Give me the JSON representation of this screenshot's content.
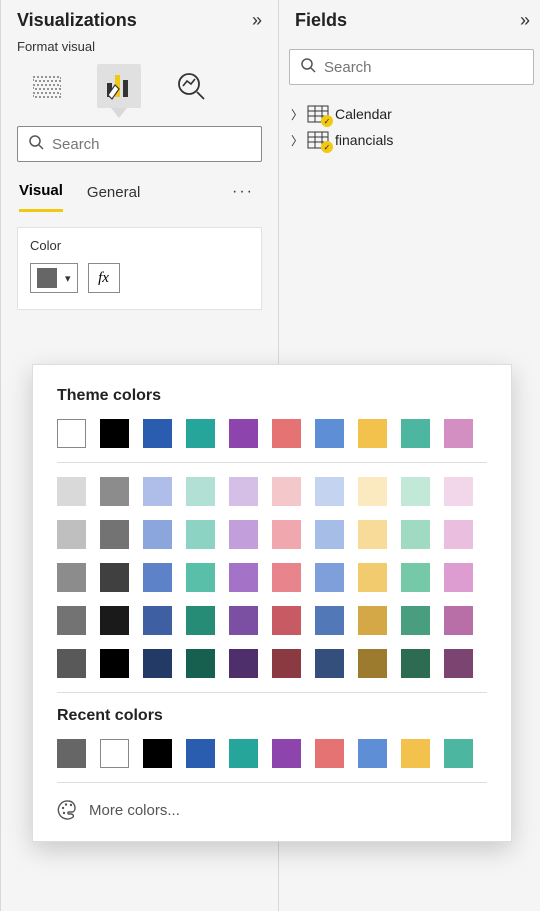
{
  "viz": {
    "title": "Visualizations",
    "subtitle": "Format visual",
    "search_placeholder": "Search",
    "tabs": {
      "visual": "Visual",
      "general": "General"
    },
    "card": {
      "label": "Color",
      "fx": "fx"
    }
  },
  "fields": {
    "title": "Fields",
    "search_placeholder": "Search",
    "items": [
      {
        "label": "Calendar"
      },
      {
        "label": "financials"
      }
    ]
  },
  "picker": {
    "theme_heading": "Theme colors",
    "recent_heading": "Recent colors",
    "more_label": "More colors...",
    "theme_base": [
      "#FFFFFF",
      "#000000",
      "#2A5DB0",
      "#26A69A",
      "#8E44AD",
      "#E57373",
      "#5E8ED6",
      "#F2C24C",
      "#4DB6A0",
      "#D48FC2"
    ],
    "theme_tints": [
      [
        "#D9D9D9",
        "#8C8C8C",
        "#AEBEE8",
        "#B2E0D5",
        "#D6BFE6",
        "#F4C7CB",
        "#C4D3EF",
        "#FBE9BF",
        "#C2E8D8",
        "#F2D7EA"
      ],
      [
        "#BFBFBF",
        "#737373",
        "#8BA5DD",
        "#8CD3C3",
        "#C29FDB",
        "#F0A8AE",
        "#A6BDE7",
        "#F8DB99",
        "#A0DAC3",
        "#EABEDF"
      ],
      [
        "#8C8C8C",
        "#404040",
        "#5E82C8",
        "#59BFA8",
        "#A472C7",
        "#E8848C",
        "#7F9FDB",
        "#F2CB6E",
        "#76C9A8",
        "#DE9DD0"
      ],
      [
        "#737373",
        "#1A1A1A",
        "#3E5FA1",
        "#268C75",
        "#7B4FA2",
        "#C85A63",
        "#5378B8",
        "#D4A847",
        "#4A9E80",
        "#B86FA8"
      ],
      [
        "#595959",
        "#000000",
        "#243A66",
        "#175F4E",
        "#4E2E6B",
        "#8C3A41",
        "#354F7D",
        "#9C7A2E",
        "#2E6B53",
        "#7C4470"
      ]
    ],
    "recent": [
      "#666666",
      "#FFFFFF",
      "#000000",
      "#2A5DB0",
      "#26A69A",
      "#8E44AD",
      "#E57373",
      "#5E8ED6",
      "#F2C24C",
      "#4DB6A0"
    ]
  }
}
